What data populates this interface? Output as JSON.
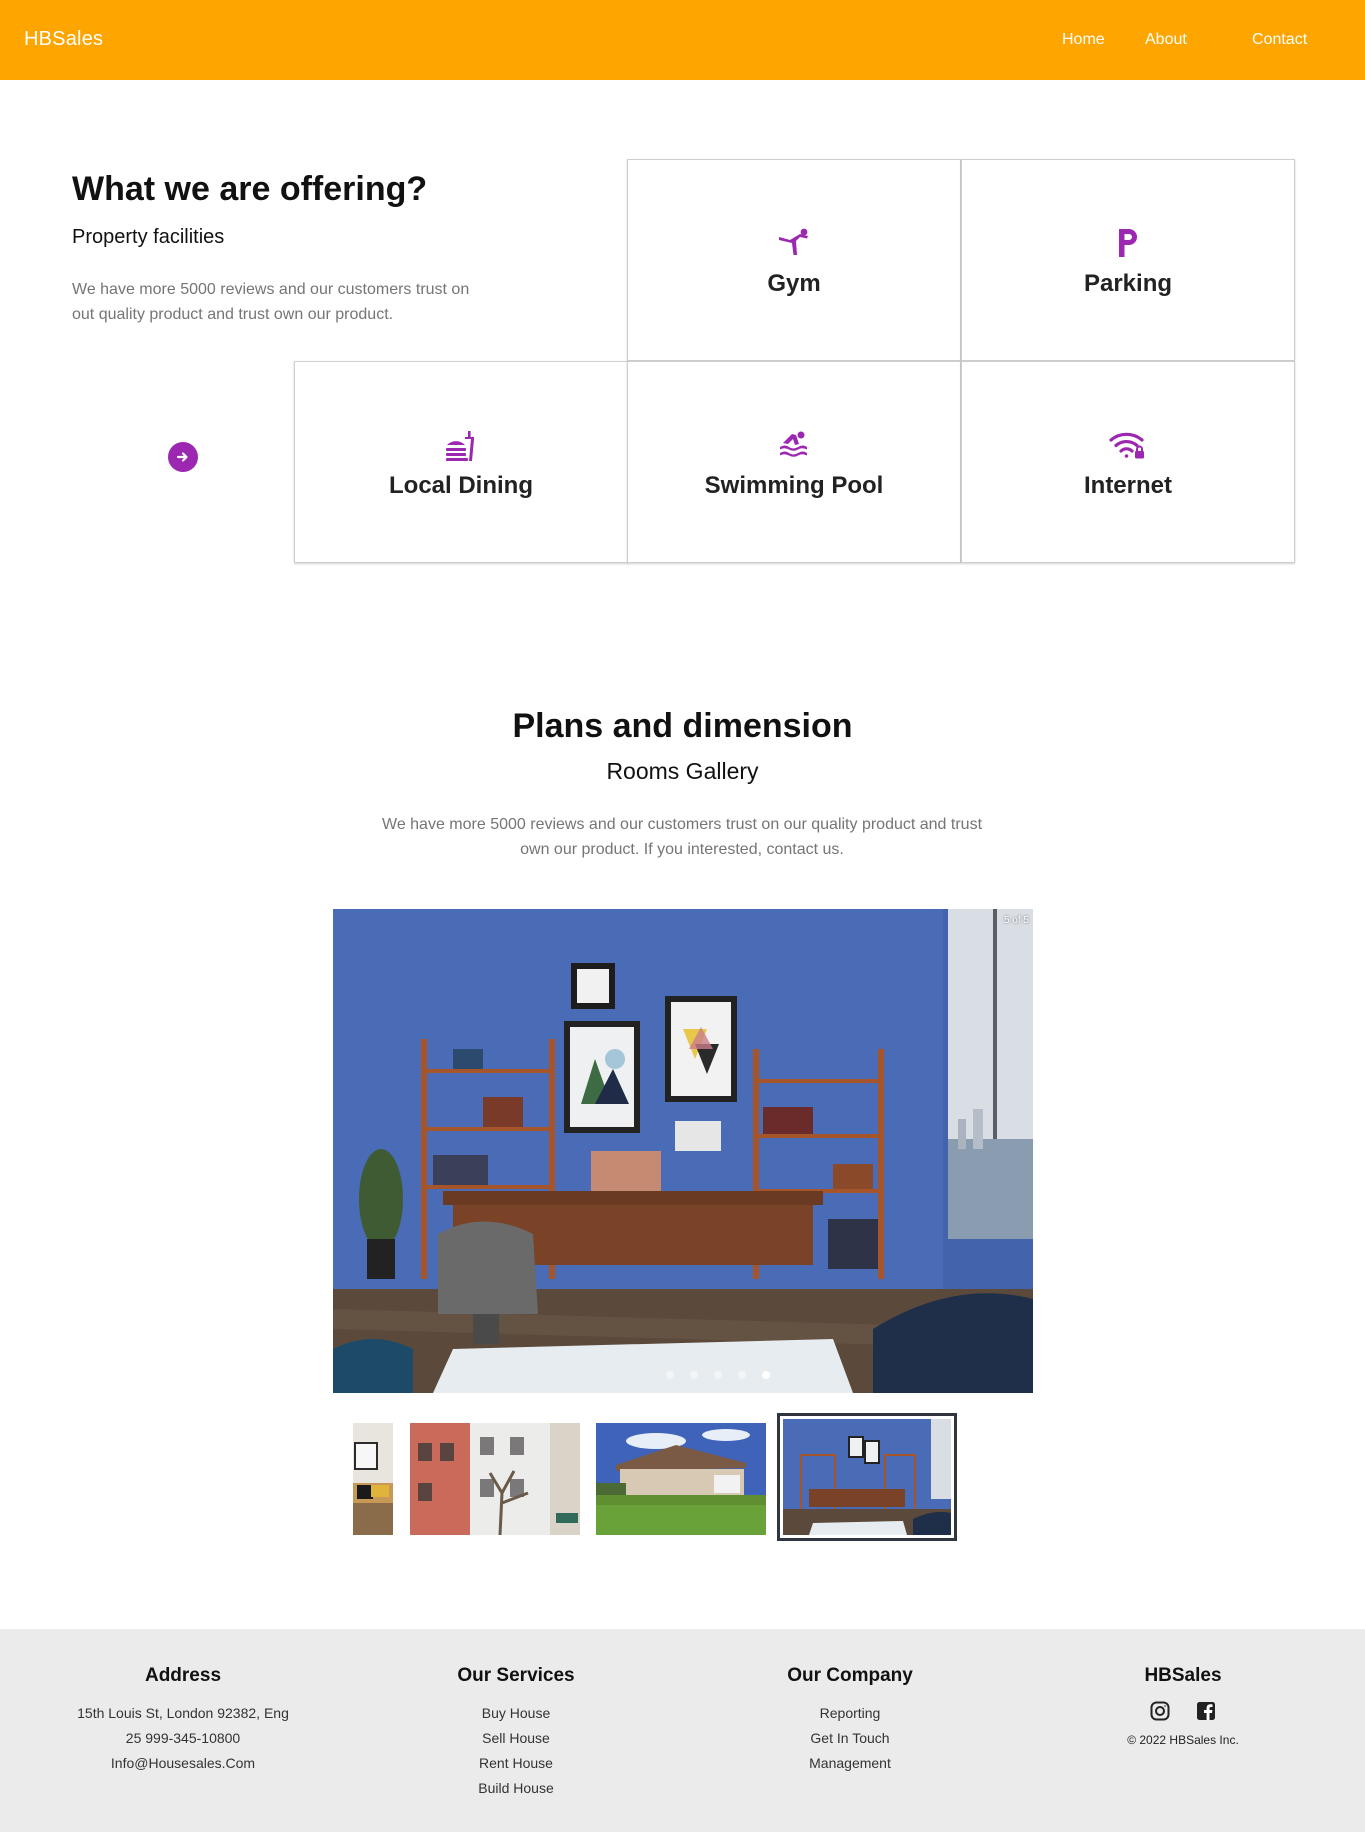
{
  "header": {
    "brand": "HBSales",
    "nav": {
      "home": "Home",
      "about": "About",
      "contact": "Contact"
    },
    "color": "#ffa500"
  },
  "offering": {
    "title": "What we are offering?",
    "subtitle": "Property facilities",
    "description": "We have more 5000 reviews and our customers trust on out quality product and trust own our product.",
    "accent": "#9c27b0",
    "facilities": [
      {
        "label": "Gym",
        "icon": "gym-icon"
      },
      {
        "label": "Parking",
        "icon": "parking-icon"
      },
      {
        "label": "Local Dining",
        "icon": "dining-icon"
      },
      {
        "label": "Swimming Pool",
        "icon": "pool-icon"
      },
      {
        "label": "Internet",
        "icon": "wifi-lock-icon"
      }
    ]
  },
  "plans": {
    "title": "Plans and dimension",
    "subtitle": "Rooms Gallery",
    "description": "We have more 5000 reviews and our customers trust on our quality product and trust own our product. If you interested, contact us."
  },
  "gallery": {
    "counter": "5 of 5",
    "total": 5,
    "current": 5
  },
  "footer": {
    "address": {
      "title": "Address",
      "lines": [
        "15th Louis St, London 92382, Eng",
        "25 999-345-10800",
        "Info@Housesales.Com"
      ]
    },
    "services": {
      "title": "Our Services",
      "items": [
        "Buy House",
        "Sell House",
        "Rent House",
        "Build House"
      ]
    },
    "company": {
      "title": "Our Company",
      "items": [
        "Reporting",
        "Get In Touch",
        "Management"
      ]
    },
    "brand": {
      "title": "HBSales",
      "social": [
        "instagram-icon",
        "facebook-icon"
      ],
      "copyright": "© 2022 HBSales Inc."
    }
  }
}
